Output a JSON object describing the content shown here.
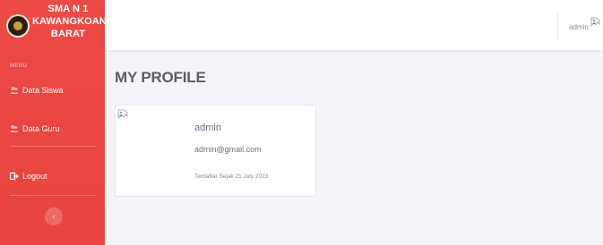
{
  "sidebar": {
    "brand_line1": "SMA N 1",
    "brand_line2": "KAWANGKOAN",
    "brand_line3": "BARAT",
    "logo_icon": "school-emblem",
    "menu_heading": "MENU",
    "items": [
      {
        "label": "Data Siswa",
        "icon": "users-icon"
      },
      {
        "label": "Data Guru",
        "icon": "users-icon"
      },
      {
        "label": "Logout",
        "icon": "sign-out-icon"
      }
    ],
    "toggle_glyph": "‹"
  },
  "topbar": {
    "username": "admin",
    "avatar_icon": "broken-image-icon"
  },
  "main": {
    "page_title": "MY PROFILE",
    "profile": {
      "name": "admin",
      "email": "admin@gmail.com",
      "registered": "Terdaftar Sejak 21 July 2023",
      "photo_icon": "broken-image-icon"
    }
  },
  "colors": {
    "sidebar": "#e8433f",
    "background": "#f3f5f9",
    "card": "#ffffff"
  }
}
